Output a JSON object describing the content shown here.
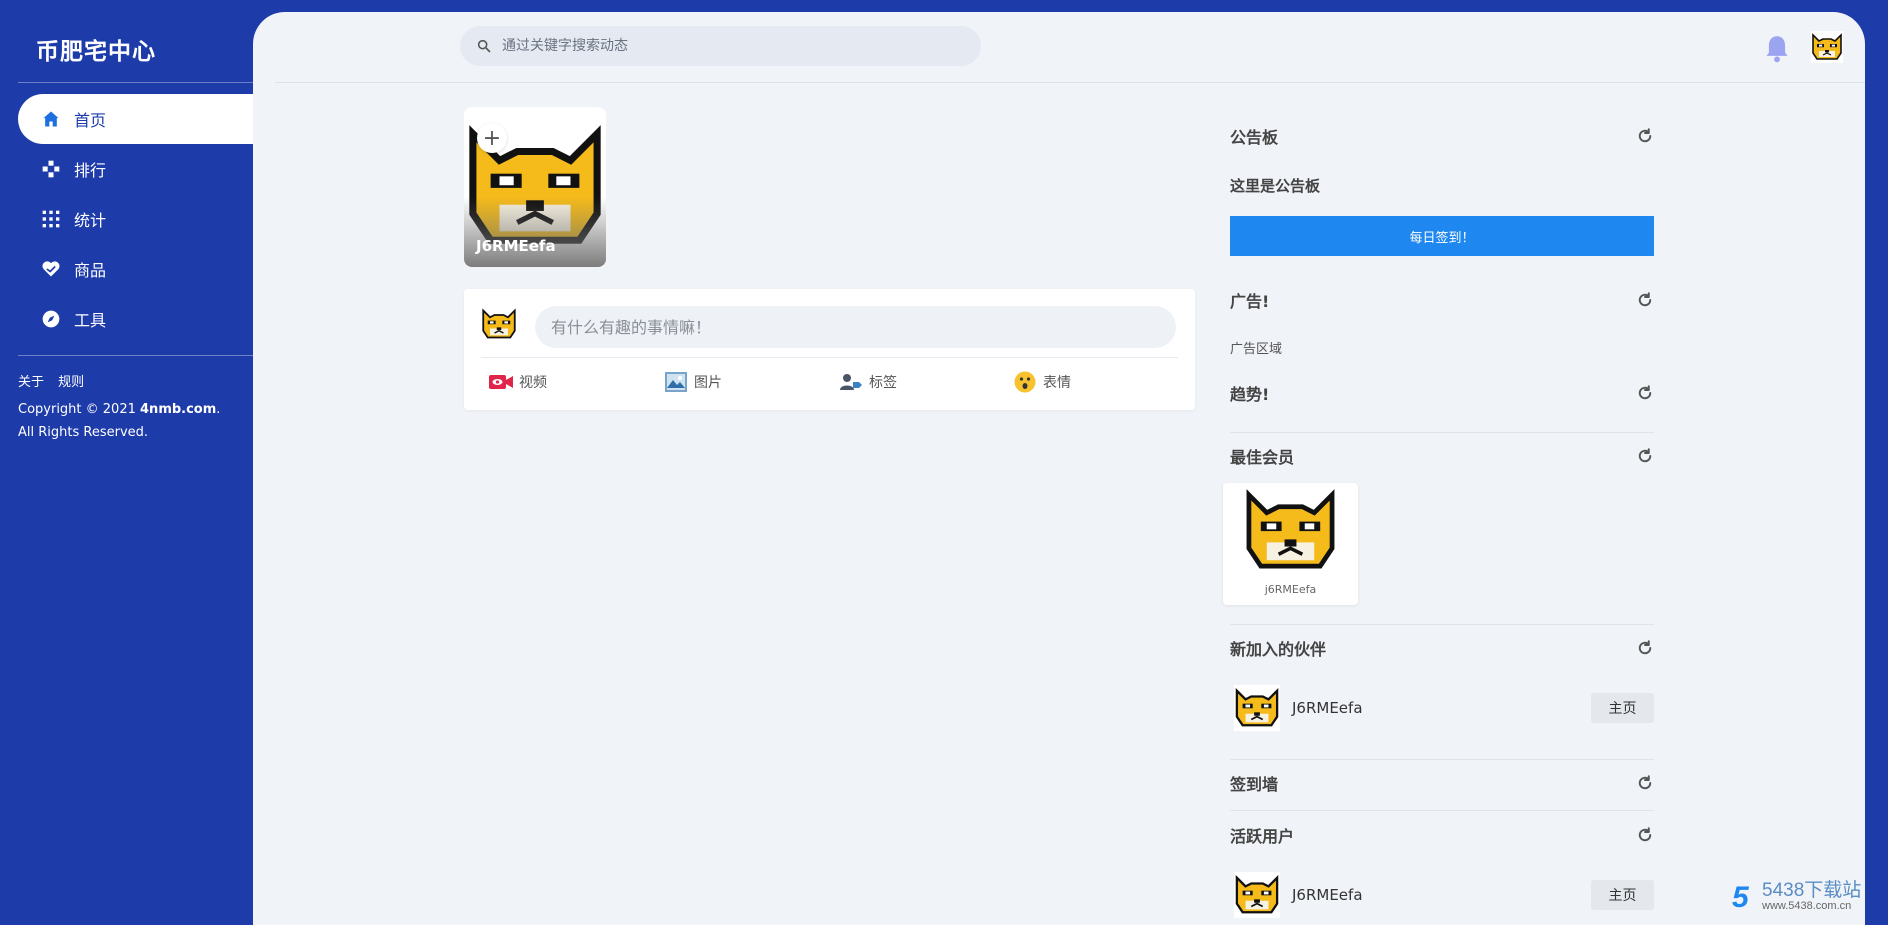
{
  "sidebar": {
    "logo": "币肥宅中心",
    "nav": [
      {
        "label": "首页",
        "icon": "home-icon",
        "active": true
      },
      {
        "label": "排行",
        "icon": "gamepad-icon"
      },
      {
        "label": "统计",
        "icon": "grid-icon"
      },
      {
        "label": "商品",
        "icon": "heart-icon"
      },
      {
        "label": "工具",
        "icon": "compass-icon"
      }
    ],
    "links": [
      "关于",
      "规则"
    ],
    "copyright_prefix": "Copyright © 2021 ",
    "copyright_brand": "4nmb.com",
    "copyright_suffix": ". All Rights Reserved."
  },
  "header": {
    "search_placeholder": "通过关键字搜索动态"
  },
  "profile": {
    "name": "J6RMEefa",
    "add_symbol": "+"
  },
  "post": {
    "placeholder": "有什么有趣的事情嘛！",
    "actions": [
      {
        "label": "视频",
        "icon": "video-icon"
      },
      {
        "label": "图片",
        "icon": "image-icon"
      },
      {
        "label": "标签",
        "icon": "tag-user-icon"
      },
      {
        "label": "表情",
        "icon": "emoji-icon"
      }
    ]
  },
  "right": {
    "notice_title": "公告板",
    "notice_text": "这里是公告板",
    "signin_label": "每日签到！",
    "ad_title": "广告!",
    "ad_text": "广告区域",
    "trend_title": "趋势!",
    "best_title": "最佳会员",
    "best_member": "j6RMEefa",
    "new_title": "新加入的伙伴",
    "new_user": "J6RMEefa",
    "home_label": "主页",
    "checkin_title": "签到墙",
    "active_title": "活跃用户",
    "active_user": "J6RMEefa"
  },
  "watermark": {
    "digit": "5",
    "title": "5438下载站",
    "url": "www.5438.com.cn"
  },
  "colors": {
    "primary": "#1e3baa",
    "button": "#1f87f0",
    "background": "#f0f3f8"
  }
}
